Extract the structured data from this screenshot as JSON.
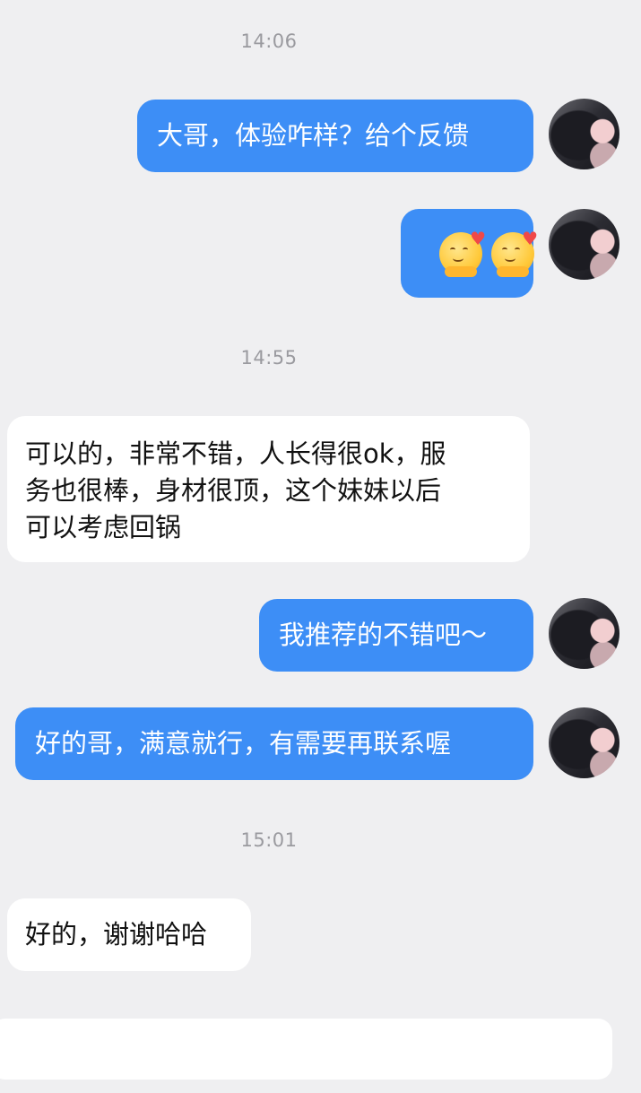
{
  "chat": {
    "timestamps": [
      "14:06",
      "14:55",
      "15:01"
    ],
    "messages": [
      {
        "side": "out",
        "text": "大哥，体验咋样？给个反馈"
      },
      {
        "side": "out",
        "content": [
          "hug-heart-emoji",
          "hug-heart-emoji"
        ]
      },
      {
        "side": "in",
        "lines": [
          "可以的，非常不错，人长得很ok，服",
          "务也很棒，身材很顶，这个妹妹以后",
          "可以考虑回锅"
        ]
      },
      {
        "side": "out",
        "text": "我推荐的不错吧～"
      },
      {
        "side": "out",
        "text": "好的哥，满意就行，有需要再联系喔"
      },
      {
        "side": "in",
        "text": "好的，谢谢哈哈"
      }
    ]
  },
  "colors": {
    "outgoing_bubble": "#3d8ef6",
    "incoming_bubble": "#ffffff",
    "background": "#efeff1",
    "timestamp": "#9a9a9f"
  },
  "input": {
    "placeholder": ""
  }
}
